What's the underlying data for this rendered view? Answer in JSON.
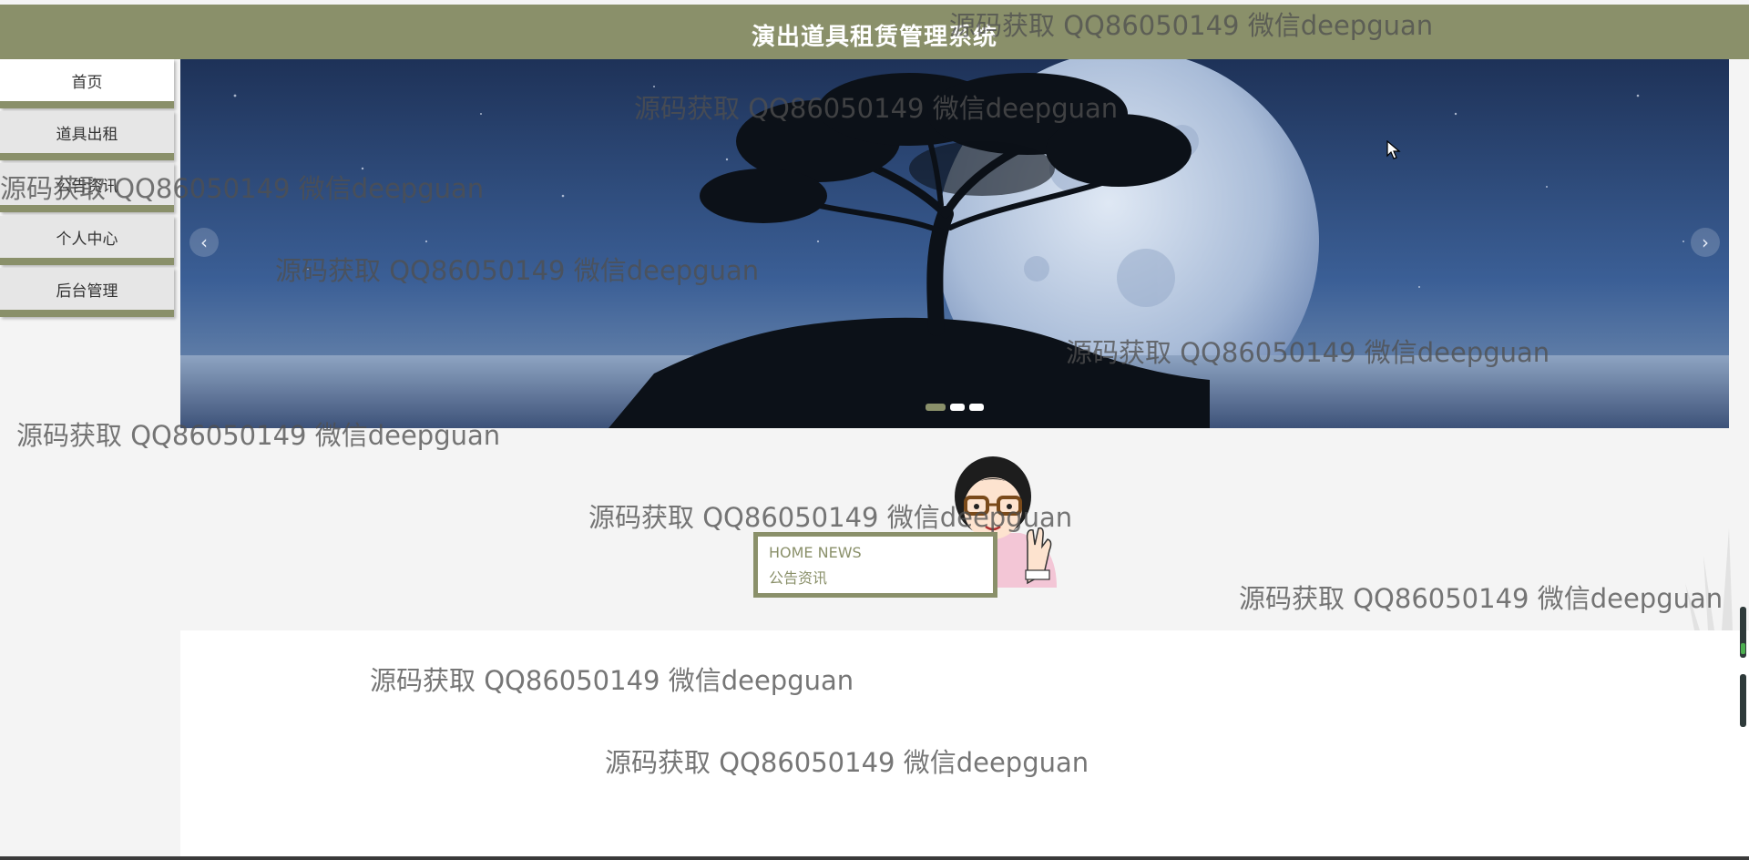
{
  "header": {
    "title": "演出道具租赁管理系统"
  },
  "sidebar": {
    "items": [
      {
        "label": "首页",
        "active": true
      },
      {
        "label": "道具出租",
        "active": false
      },
      {
        "label": "公告资讯",
        "active": false
      },
      {
        "label": "个人中心",
        "active": false
      },
      {
        "label": "后台管理",
        "active": false
      }
    ]
  },
  "banner": {
    "prev_icon": "chevron-left-icon",
    "next_icon": "chevron-right-icon",
    "prev_glyph": "‹",
    "next_glyph": "›",
    "slide_count": 3,
    "active_slide": 1
  },
  "news": {
    "title_en": "HOME NEWS",
    "title_cn": "公告资讯"
  },
  "watermark": {
    "text": "源码获取 QQ86050149 微信deepguan"
  },
  "colors": {
    "accent": "#8a906a",
    "page_bg": "#f4f4f4",
    "nav_bg": "#e6e6e6",
    "nav_active_bg": "#ffffff",
    "content_bg": "#ffffff"
  }
}
